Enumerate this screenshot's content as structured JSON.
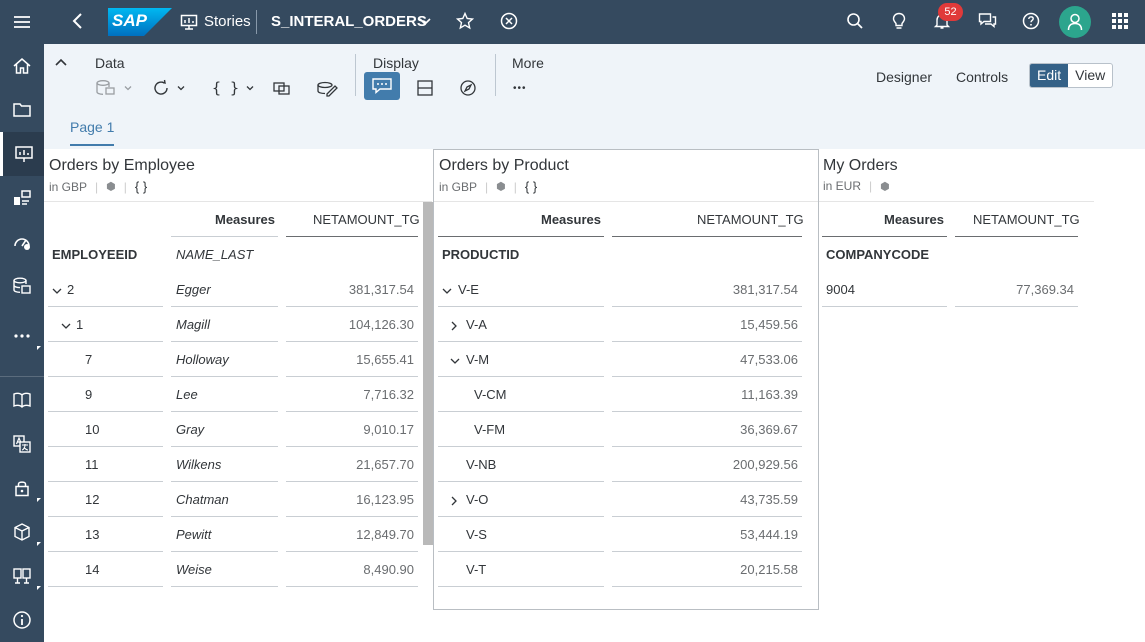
{
  "shell": {
    "brand": "SAP",
    "app_name": "Stories",
    "document_title": "S_INTERAL_ORDERS",
    "notification_count": "52"
  },
  "left_nav": {
    "items": [
      "menu-icon",
      "home-icon",
      "folder-icon",
      "stories-icon",
      "analytics-icon",
      "dashboard-icon",
      "datasets-icon",
      "more-icon",
      "book-icon",
      "translate-icon",
      "security-icon",
      "deploy-icon",
      "designer-icon",
      "info-icon"
    ]
  },
  "toolbar": {
    "data_label": "Data",
    "display_label": "Display",
    "more_label": "More",
    "designer_label": "Designer",
    "controls_label": "Controls",
    "edit_label": "Edit",
    "view_label": "View",
    "more_dots": "•••"
  },
  "page_tabs": [
    {
      "label": "Page 1"
    }
  ],
  "widgets": {
    "employee": {
      "title": "Orders by Employee",
      "currency": "in GBP",
      "measures_header": "Measures",
      "measure_col": "NETAMOUNT_TG",
      "dim_header": "EMPLOYEEID",
      "attr_header": "NAME_LAST",
      "rows": [
        {
          "id": "2",
          "name": "Egger",
          "value": "381,317.54"
        },
        {
          "id": "1",
          "name": "Magill",
          "value": "104,126.30"
        },
        {
          "id": "7",
          "name": "Holloway",
          "value": "15,655.41"
        },
        {
          "id": "9",
          "name": "Lee",
          "value": "7,716.32"
        },
        {
          "id": "10",
          "name": "Gray",
          "value": "9,010.17"
        },
        {
          "id": "11",
          "name": "Wilkens",
          "value": "21,657.70"
        },
        {
          "id": "12",
          "name": "Chatman",
          "value": "16,123.95"
        },
        {
          "id": "13",
          "name": "Pewitt",
          "value": "12,849.70"
        },
        {
          "id": "14",
          "name": "Weise",
          "value": "8,490.90"
        }
      ]
    },
    "product": {
      "title": "Orders by Product",
      "currency": "in GBP",
      "measures_header": "Measures",
      "measure_col": "NETAMOUNT_TG",
      "dim_header": "PRODUCTID",
      "rows": [
        {
          "id": "V-E",
          "value": "381,317.54"
        },
        {
          "id": "V-A",
          "value": "15,459.56"
        },
        {
          "id": "V-M",
          "value": "47,533.06"
        },
        {
          "id": "V-CM",
          "value": "11,163.39"
        },
        {
          "id": "V-FM",
          "value": "36,369.67"
        },
        {
          "id": "V-NB",
          "value": "200,929.56"
        },
        {
          "id": "V-O",
          "value": "43,735.59"
        },
        {
          "id": "V-S",
          "value": "53,444.19"
        },
        {
          "id": "V-T",
          "value": "20,215.58"
        }
      ]
    },
    "orders": {
      "title": "My Orders",
      "currency": "in EUR",
      "measures_header": "Measures",
      "measure_col": "NETAMOUNT_TG",
      "dim_header": "COMPANYCODE",
      "rows": [
        {
          "id": "9004",
          "value": "77,369.34"
        }
      ]
    }
  },
  "colors": {
    "shell": "#354a5f",
    "toolbar_bg": "#eff4f9",
    "accent": "#427cac",
    "badge": "#e03a3a",
    "avatar": "#2ca58d"
  }
}
